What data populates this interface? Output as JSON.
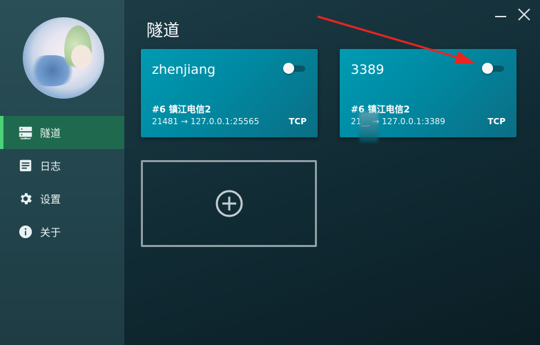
{
  "sidebar": {
    "items": [
      {
        "label": "隧道",
        "icon": "server-icon",
        "active": true
      },
      {
        "label": "日志",
        "icon": "document-icon",
        "active": false
      },
      {
        "label": "设置",
        "icon": "gear-icon",
        "active": false
      },
      {
        "label": "关于",
        "icon": "info-icon",
        "active": false
      }
    ]
  },
  "main": {
    "title": "隧道",
    "tunnels": [
      {
        "name": "zhenjiang",
        "node": "#6 镇江电信2",
        "mapping": "21481 → 127.0.0.1:25565",
        "protocol": "TCP",
        "enabled": false
      },
      {
        "name": "3389",
        "node": "#6 镇江电信2",
        "mapping": "21__ → 127.0.0.1:3389",
        "protocol": "TCP",
        "enabled": false
      }
    ],
    "add_icon": "plus-circle-icon"
  },
  "window": {
    "minimize_icon": "minimize-icon",
    "close_icon": "close-icon"
  },
  "colors": {
    "sidebar_bg": "#24474f",
    "active_item_bg": "#1f6a4e",
    "active_indicator": "#4cd37a",
    "card_bg": "#0089a2",
    "main_bg": "#102a33",
    "annotation_arrow": "#e8251f"
  }
}
